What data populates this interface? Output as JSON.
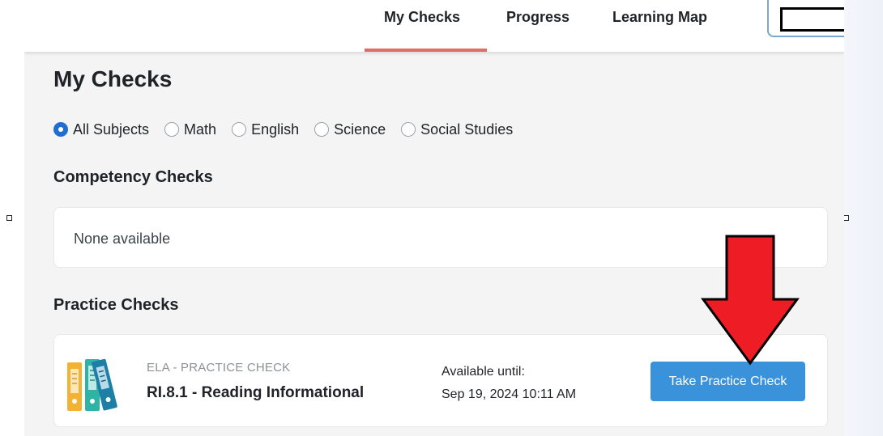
{
  "nav": {
    "tabs": [
      {
        "label": "My Checks",
        "active": true
      },
      {
        "label": "Progress",
        "active": false
      },
      {
        "label": "Learning Map",
        "active": false
      }
    ],
    "active_color": "#e06d64"
  },
  "page": {
    "title": "My Checks"
  },
  "filters": {
    "options": [
      {
        "label": "All Subjects",
        "selected": true
      },
      {
        "label": "Math",
        "selected": false
      },
      {
        "label": "English",
        "selected": false
      },
      {
        "label": "Science",
        "selected": false
      },
      {
        "label": "Social Studies",
        "selected": false
      }
    ],
    "selected_color": "#1f6fd0"
  },
  "competency": {
    "heading": "Competency Checks",
    "empty_text": "None available"
  },
  "practice": {
    "heading": "Practice Checks",
    "items": [
      {
        "icon": "binders-icon",
        "category": "ELA - PRACTICE CHECK",
        "title": "RI.8.1 - Reading Informational",
        "available_label": "Available until:",
        "available_date": "Sep 19, 2024 10:11 AM",
        "button_label": "Take Practice Check",
        "button_color": "#3a92db"
      }
    ]
  },
  "annotation": {
    "icon": "down-arrow-icon",
    "color": "#ee1c24"
  }
}
